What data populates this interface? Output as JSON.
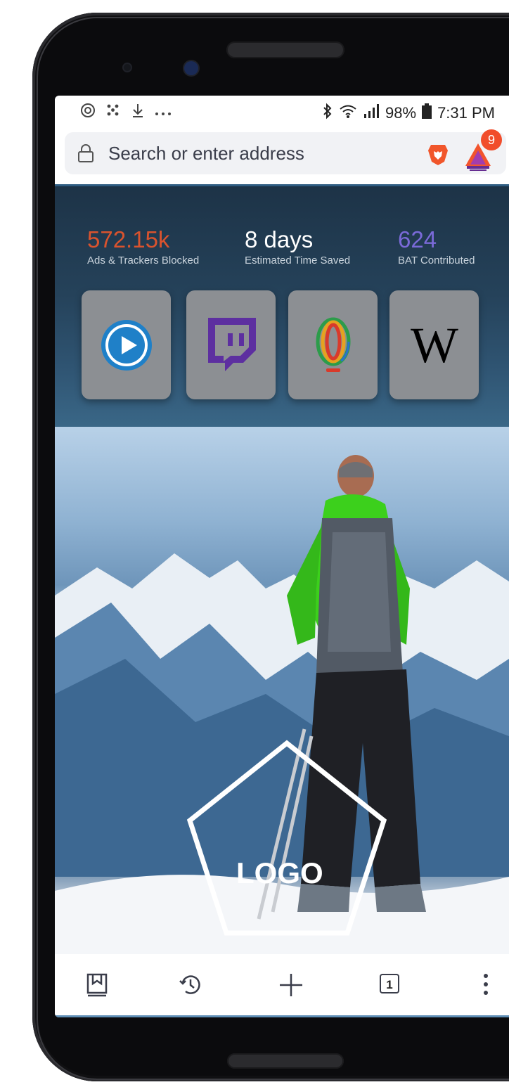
{
  "status_bar": {
    "left_icons": [
      "at-sign-icon",
      "network-sync-icon",
      "download-icon",
      "more-dots-icon"
    ],
    "battery": "98%",
    "time": "7:31 PM"
  },
  "address_bar": {
    "placeholder": "Search or enter address",
    "rewards_badge": "9"
  },
  "stats": [
    {
      "value": "572.15k",
      "label": "Ads & Trackers Blocked",
      "color": "#d9532e"
    },
    {
      "value": "8 days",
      "label": "Estimated Time Saved",
      "color": "#ffffff"
    },
    {
      "value": "624",
      "label": "BAT Contributed",
      "color": "#7a6ad8"
    }
  ],
  "top_sites": [
    {
      "name": "play-video-site-icon",
      "color": "#1f80c8"
    },
    {
      "name": "twitch-icon",
      "color": "#5d2fa0"
    },
    {
      "name": "opera-rainbow-icon",
      "color": "#e6a21f"
    },
    {
      "name": "wikipedia-icon",
      "glyph": "W"
    }
  ],
  "background": {
    "logo_text": "LOGO"
  },
  "bottom_bar": {
    "tab_count": "1"
  }
}
